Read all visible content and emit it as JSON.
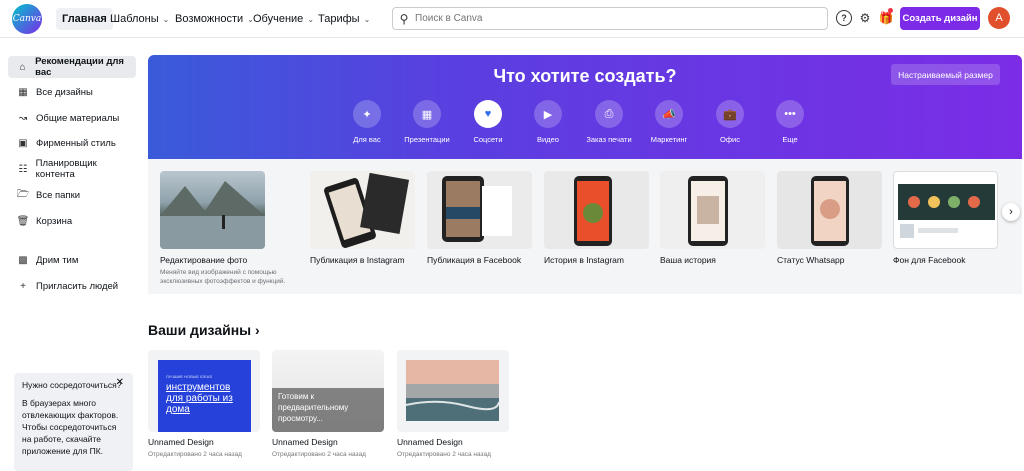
{
  "header": {
    "logo_text": "Canva",
    "nav": [
      {
        "label": "Главная",
        "active": true
      },
      {
        "label": "Шаблоны"
      },
      {
        "label": "Возможности"
      },
      {
        "label": "Обучение"
      },
      {
        "label": "Тарифы"
      }
    ],
    "search_placeholder": "Поиск в Canva",
    "create_label": "Создать дизайн",
    "avatar_letter": "A"
  },
  "sidebar": {
    "items": [
      {
        "label": "Рекомендации для вас",
        "icon": "home-icon"
      },
      {
        "label": "Все дизайны",
        "icon": "grid-icon"
      },
      {
        "label": "Общие материалы",
        "icon": "share-icon"
      },
      {
        "label": "Фирменный стиль",
        "icon": "brand-icon"
      },
      {
        "label": "Планировщик контента",
        "icon": "calendar-icon"
      },
      {
        "label": "Все папки",
        "icon": "folder-icon"
      },
      {
        "label": "Корзина",
        "icon": "trash-icon"
      },
      {
        "label": "Дрим тим",
        "icon": "team-icon"
      },
      {
        "label": "Пригласить людей",
        "icon": "plus-icon"
      }
    ],
    "focus": {
      "title": "Нужно сосредоточиться?",
      "body": "В браузерах много отвлекающих факторов. Чтобы сосредоточиться на работе, скачайте приложение для ПК."
    }
  },
  "hero": {
    "title": "Что хотите создать?",
    "custom_size_label": "Настраиваемый размер",
    "categories": [
      {
        "label": "Для вас",
        "icon": "sparkle-icon"
      },
      {
        "label": "Презентации",
        "icon": "presentation-icon"
      },
      {
        "label": "Соцсети",
        "icon": "heart-chat-icon",
        "active": true
      },
      {
        "label": "Видео",
        "icon": "video-icon"
      },
      {
        "label": "Заказ печати",
        "icon": "printer-icon"
      },
      {
        "label": "Маркетинг",
        "icon": "megaphone-icon"
      },
      {
        "label": "Офис",
        "icon": "briefcase-icon"
      },
      {
        "label": "Еще",
        "icon": "more-icon"
      }
    ]
  },
  "templates": [
    {
      "title": "Редактирование фото",
      "desc": "Меняйте вид изображений с помощью эксклюзивных фотоэффектов и функций."
    },
    {
      "title": "Публикация в Instagram",
      "desc": ""
    },
    {
      "title": "Публикация в Facebook",
      "desc": ""
    },
    {
      "title": "История в Instagram",
      "desc": ""
    },
    {
      "title": "Ваша история",
      "desc": ""
    },
    {
      "title": "Статус Whatsapp",
      "desc": ""
    },
    {
      "title": "Фон для Facebook",
      "desc": ""
    }
  ],
  "designs": {
    "title": "Ваши дизайны",
    "items": [
      {
        "name": "Unnamed Design",
        "time": "Отредактировано 2 часа назад",
        "thumb_text": "инструментов для работы из дома",
        "thumb_small": "ЛУЧШИЕ НОВЫЕ IDEAS"
      },
      {
        "name": "Unnamed Design",
        "time": "Отредактировано 2 часа назад",
        "thumb_text": "Готовим к предварительному просмотру..."
      },
      {
        "name": "Unnamed Design",
        "time": "Отредактировано 2 часа назад"
      }
    ]
  }
}
